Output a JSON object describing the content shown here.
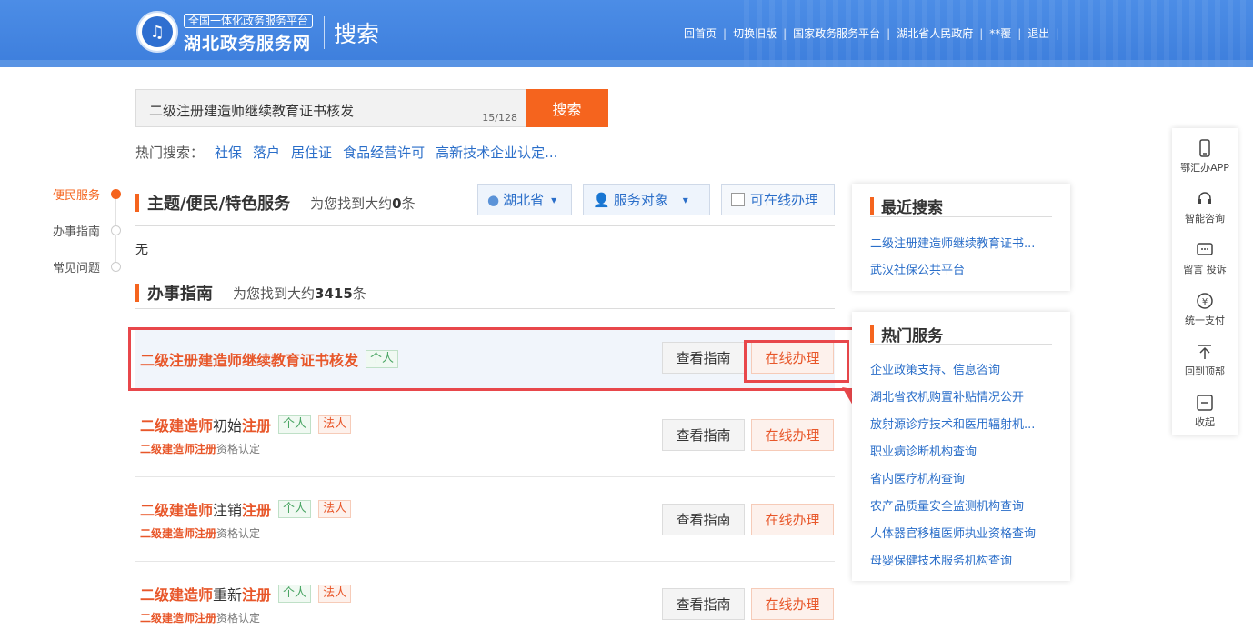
{
  "header": {
    "platform_tag": "全国一体化政务服务平台",
    "site_name": "湖北政务服务网",
    "page_word": "搜索",
    "nav": [
      "回首页",
      "切换旧版",
      "国家政务服务平台",
      "湖北省人民政府",
      "**覆",
      "退出"
    ]
  },
  "search": {
    "value": "二级注册建造师继续教育证书核发",
    "count": "15/128",
    "button": "搜索",
    "hot_label": "热门搜索：",
    "hot_items": [
      "社保",
      "落户",
      "居住证",
      "食品经营许可",
      "高新技术企业认定..."
    ]
  },
  "timeline": [
    "便民服务",
    "办事指南",
    "常见问题"
  ],
  "section1": {
    "title": "主题/便民/特色服务",
    "found_prefix": "为您找到大约",
    "found_count": "0",
    "found_suffix": "条",
    "empty": "无"
  },
  "filters": {
    "region": "湖北省",
    "target": "服务对象",
    "online": "可在线办理"
  },
  "section2": {
    "title": "办事指南",
    "found_prefix": "为您找到大约",
    "found_count": "3415",
    "found_suffix": "条"
  },
  "results": [
    {
      "title_kw": "二级注册建造师继续教育证书核发",
      "tags": [
        "个人"
      ]
    },
    {
      "t1": "二级建造师",
      "t2": "初始",
      "t3": "注册",
      "tags": [
        "个人",
        "法人"
      ],
      "sub_kw": "二级建造师注册",
      "sub_rest": "资格认定"
    },
    {
      "t1": "二级建造师",
      "t2": "注销",
      "t3": "注册",
      "tags": [
        "个人",
        "法人"
      ],
      "sub_kw": "二级建造师注册",
      "sub_rest": "资格认定"
    },
    {
      "t1": "二级建造师",
      "t2": "重新",
      "t3": "注册",
      "tags": [
        "个人",
        "法人"
      ],
      "sub_kw": "二级建造师注册",
      "sub_rest": "资格认定"
    }
  ],
  "buttons": {
    "guide": "查看指南",
    "online": "在线办理"
  },
  "recent": {
    "title": "最近搜索",
    "items": [
      "二级注册建造师继续教育证书...",
      "武汉社保公共平台"
    ]
  },
  "hot_services": {
    "title": "热门服务",
    "items": [
      "企业政策支持、信息咨询",
      "湖北省农机购置补贴情况公开",
      "放射源诊疗技术和医用辐射机...",
      "职业病诊断机构查询",
      "省内医疗机构查询",
      "农产品质量安全监测机构查询",
      "人体器官移植医师执业资格查询",
      "母婴保健技术服务机构查询"
    ]
  },
  "sidebar": [
    "鄂汇办APP",
    "智能咨询",
    "留言 投诉",
    "统一支付",
    "回到顶部",
    "收起"
  ],
  "colors": {
    "header_blue": "#3d7edc",
    "accent_orange": "#f5641e",
    "link_blue": "#2a6ec9",
    "annotation_red": "#e8474b"
  }
}
